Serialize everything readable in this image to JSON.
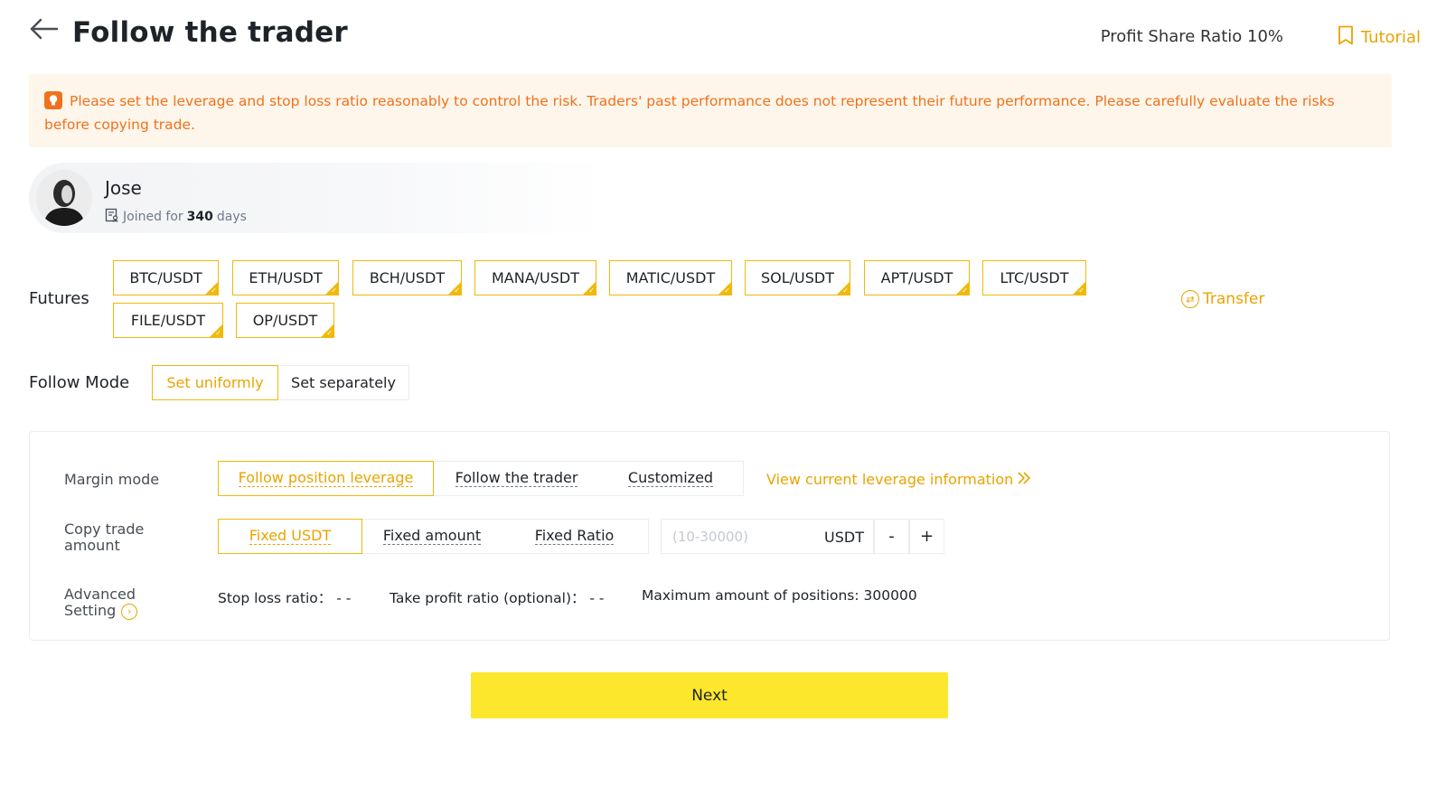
{
  "header": {
    "title": "Follow the trader",
    "profit_share": "Profit Share Ratio 10%",
    "tutorial_label": "Tutorial"
  },
  "warning": {
    "text": "Please set the leverage and stop loss ratio reasonably to control the risk. Traders' past performance does not represent their future performance. Please carefully evaluate the risks before copying trade."
  },
  "trader": {
    "name": "Jose",
    "joined_prefix": "Joined for",
    "joined_days": "340",
    "joined_suffix": "days"
  },
  "futures": {
    "label": "Futures",
    "pairs": [
      "BTC/USDT",
      "ETH/USDT",
      "BCH/USDT",
      "MANA/USDT",
      "MATIC/USDT",
      "SOL/USDT",
      "APT/USDT",
      "LTC/USDT",
      "FILE/USDT",
      "OP/USDT"
    ],
    "transfer_label": "Transfer"
  },
  "follow_mode": {
    "label": "Follow Mode",
    "options": [
      "Set uniformly",
      "Set separately"
    ],
    "selected": "Set uniformly"
  },
  "settings": {
    "margin_mode": {
      "label": "Margin mode",
      "options": [
        "Follow position leverage",
        "Follow the trader",
        "Customized"
      ],
      "selected": "Follow position leverage",
      "link": "View current leverage information"
    },
    "copy_amount": {
      "label_line1": "Copy trade",
      "label_line2": "amount",
      "options": [
        "Fixed USDT",
        "Fixed amount",
        "Fixed Ratio"
      ],
      "selected": "Fixed USDT",
      "placeholder": "(10-30000)",
      "unit": "USDT",
      "minus": "-",
      "plus": "+"
    },
    "advanced": {
      "label_line1": "Advanced",
      "label_line2": "Setting",
      "stop_loss": "Stop loss ratio： - -",
      "take_profit": "Take profit ratio (optional)： - -",
      "max_positions": "Maximum amount of positions: 300000"
    }
  },
  "next_label": "Next",
  "colors": {
    "accent": "#f0b90b",
    "accent_text": "#e9a400",
    "warning_text": "#f0711d",
    "warning_bg": "#fef6ea",
    "primary_button": "#fce72c"
  }
}
